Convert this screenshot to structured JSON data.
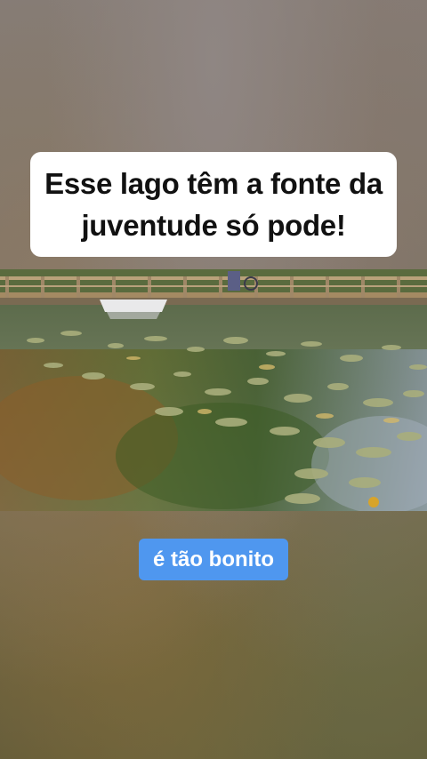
{
  "caption": {
    "text": "Esse lago têm a fonte da juventude só pode!"
  },
  "video": {
    "scene": "lake-with-lily-pads-and-wooden-bridge"
  },
  "subtitle": {
    "text": "é tão bonito"
  },
  "colors": {
    "caption_bg": "#ffffff",
    "caption_text": "#111111",
    "subtitle_bg": "#4f97ef",
    "subtitle_text": "#ffffff"
  }
}
